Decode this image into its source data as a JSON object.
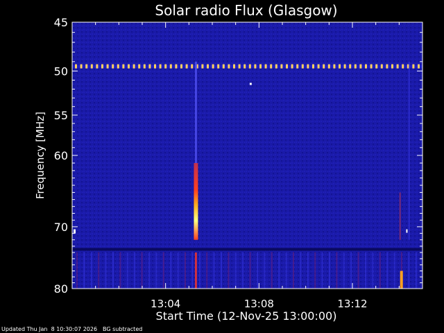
{
  "chart_data": {
    "type": "heatmap",
    "title": "Solar radio Flux (Glasgow)",
    "xlabel": "Start Time (12-Nov-25 13:00:00)",
    "ylabel": "Frequency [MHz]",
    "x_unit": "minutes after 13:00",
    "xlim": [
      0,
      15
    ],
    "ylim": [
      80,
      45
    ],
    "y_scale": "log",
    "x_ticks": [
      {
        "value": 4,
        "label": "13:04"
      },
      {
        "value": 8,
        "label": "13:08"
      },
      {
        "value": 12,
        "label": "13:12"
      }
    ],
    "y_ticks": [
      {
        "value": 45,
        "label": "45"
      },
      {
        "value": 50,
        "label": "50"
      },
      {
        "value": 55,
        "label": "55"
      },
      {
        "value": 60,
        "label": "60"
      },
      {
        "value": 70,
        "label": "70"
      },
      {
        "value": 80,
        "label": "80"
      }
    ],
    "background_color": "#1a1aa8",
    "colormap": [
      "#1a1aa8",
      "#3a3ae8",
      "#c03050",
      "#ff4020",
      "#ffb020",
      "#ffff80"
    ],
    "features": [
      {
        "name": "burst",
        "time": 5.3,
        "freq_range": [
          62,
          72
        ],
        "intensity": "high"
      },
      {
        "name": "burst-upper",
        "time": 5.3,
        "freq_range": [
          49,
          62
        ],
        "intensity": "low"
      },
      {
        "name": "burst-lower",
        "time": 5.3,
        "freq_range": [
          74,
          80
        ],
        "intensity": "medium"
      },
      {
        "name": "late-burst",
        "time": 14.1,
        "freq_range": [
          77,
          80
        ],
        "intensity": "high"
      },
      {
        "name": "interference-line",
        "freq": 49.5,
        "intensity": "medium"
      },
      {
        "name": "band-gap",
        "freq": 73.5,
        "intensity": "low"
      }
    ]
  },
  "footer": {
    "updated": "Updated Thu Jan  8 10:30:07 2026",
    "note": "BG subtracted"
  }
}
